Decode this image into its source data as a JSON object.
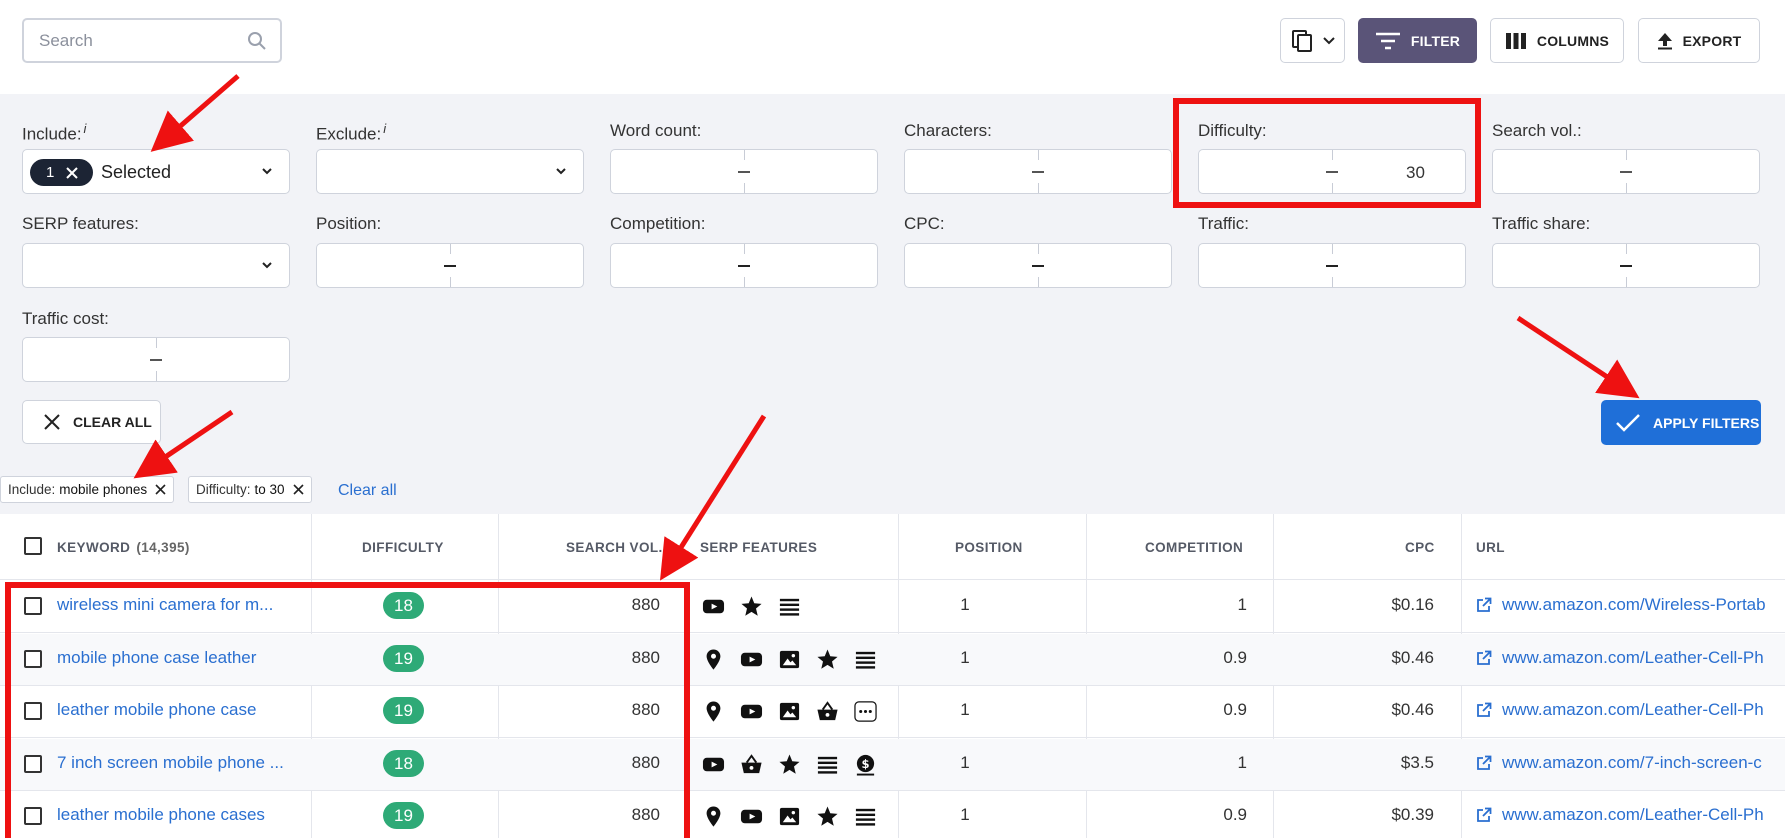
{
  "search": {
    "placeholder": "Search"
  },
  "toolbar": {
    "filter_label": "FILTER",
    "columns_label": "COLUMNS",
    "export_label": "EXPORT"
  },
  "filters": {
    "include": {
      "label": "Include:",
      "info": "i",
      "count": "1",
      "selected_text": "Selected"
    },
    "exclude": {
      "label": "Exclude:",
      "info": "i"
    },
    "word_count": {
      "label": "Word count:"
    },
    "characters": {
      "label": "Characters:"
    },
    "difficulty": {
      "label": "Difficulty:",
      "to": "30"
    },
    "search_vol": {
      "label": "Search vol.:"
    },
    "serp_features": {
      "label": "SERP features:"
    },
    "position": {
      "label": "Position:"
    },
    "competition": {
      "label": "Competition:"
    },
    "cpc": {
      "label": "CPC:"
    },
    "traffic": {
      "label": "Traffic:"
    },
    "traffic_share": {
      "label": "Traffic share:"
    },
    "traffic_cost": {
      "label": "Traffic cost:"
    },
    "clear_all_button": "CLEAR ALL",
    "apply_button": "APPLY FILTERS"
  },
  "active_tags": [
    {
      "key": "Include:",
      "value": "mobile phones"
    },
    {
      "key": "Difficulty:",
      "value": "to 30"
    }
  ],
  "clear_all_link": "Clear all",
  "table": {
    "headers": {
      "keyword": "KEYWORD",
      "keyword_count": "(14,395)",
      "difficulty": "DIFFICULTY",
      "search_vol": "SEARCH VOL.",
      "serp_features": "SERP FEATURES",
      "position": "POSITION",
      "competition": "COMPETITION",
      "cpc": "CPC",
      "url": "URL"
    },
    "rows": [
      {
        "keyword": "wireless mini camera for m...",
        "difficulty": "18",
        "search_vol": "880",
        "serp": [
          "youtube-icon",
          "star-icon",
          "list-icon"
        ],
        "position": "1",
        "competition": "1",
        "cpc": "$0.16",
        "url": "www.amazon.com/Wireless-Portab"
      },
      {
        "keyword": "mobile phone case leather",
        "difficulty": "19",
        "search_vol": "880",
        "serp": [
          "pin-icon",
          "youtube-icon",
          "image-icon",
          "star-icon",
          "list-icon"
        ],
        "position": "1",
        "competition": "0.9",
        "cpc": "$0.46",
        "url": "www.amazon.com/Leather-Cell-Ph"
      },
      {
        "keyword": "leather mobile phone case",
        "difficulty": "19",
        "search_vol": "880",
        "serp": [
          "pin-icon",
          "youtube-icon",
          "image-icon",
          "basket-icon",
          "more-icon"
        ],
        "position": "1",
        "competition": "0.9",
        "cpc": "$0.46",
        "url": "www.amazon.com/Leather-Cell-Ph"
      },
      {
        "keyword": "7 inch screen mobile phone ...",
        "difficulty": "18",
        "search_vol": "880",
        "serp": [
          "youtube-icon",
          "basket-icon",
          "star-icon",
          "list-icon",
          "dollar-icon"
        ],
        "position": "1",
        "competition": "1",
        "cpc": "$3.5",
        "url": "www.amazon.com/7-inch-screen-c"
      },
      {
        "keyword": "leather mobile phone cases",
        "difficulty": "19",
        "search_vol": "880",
        "serp": [
          "pin-icon",
          "youtube-icon",
          "image-icon",
          "star-icon",
          "list-icon"
        ],
        "position": "1",
        "competition": "0.9",
        "cpc": "$0.39",
        "url": "www.amazon.com/Leather-Cell-Ph"
      }
    ]
  },
  "colors": {
    "difficulty_badge": "#2eaa77",
    "link": "#2a6fd0",
    "filter_button": "#5a5478",
    "apply_button": "#1f6fd8",
    "annotation": "#ee1111"
  }
}
